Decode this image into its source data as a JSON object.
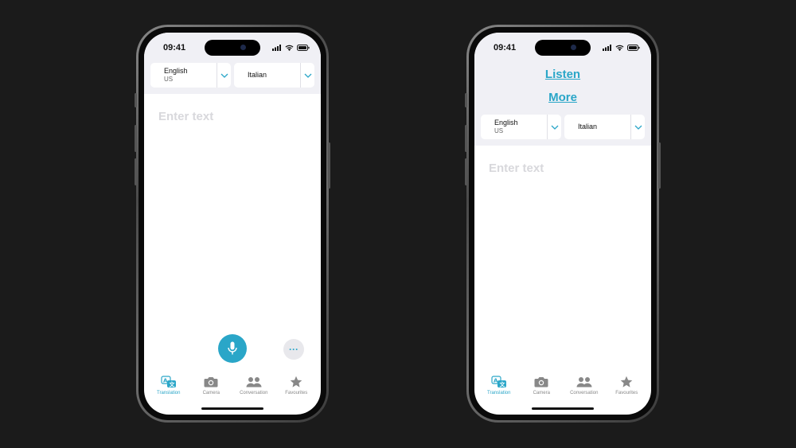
{
  "status": {
    "time": "09:41"
  },
  "colors": {
    "accent": "#2aa6c8",
    "panel": "#f0f0f5",
    "placeholder": "#d8d8dc"
  },
  "left_phone": {
    "source_lang": {
      "name": "English",
      "region": "US"
    },
    "target_lang": {
      "name": "Italian"
    },
    "input": {
      "placeholder": "Enter text"
    },
    "mic_icon": "microphone-icon",
    "more_label": "···"
  },
  "right_phone": {
    "listen_label": "Listen",
    "more_label": "More",
    "source_lang": {
      "name": "English",
      "region": "US"
    },
    "target_lang": {
      "name": "Italian"
    },
    "input": {
      "placeholder": "Enter text"
    }
  },
  "tabs": [
    {
      "label": "Translation",
      "icon": "translate-icon",
      "active": true
    },
    {
      "label": "Camera",
      "icon": "camera-icon",
      "active": false
    },
    {
      "label": "Conversation",
      "icon": "people-icon",
      "active": false
    },
    {
      "label": "Favourites",
      "icon": "star-icon",
      "active": false
    }
  ]
}
